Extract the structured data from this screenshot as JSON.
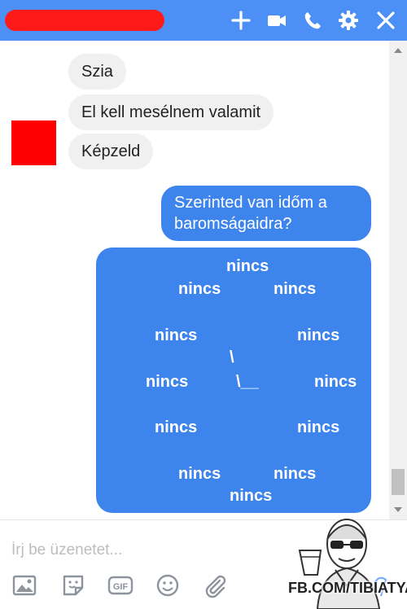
{
  "header": {
    "icons": [
      "plus-icon",
      "video-icon",
      "phone-icon",
      "gear-icon",
      "close-icon"
    ],
    "color": "#4c8ff5"
  },
  "messages": {
    "incoming": [
      "Szia",
      "El kell mesélnem valamit",
      "Képzeld"
    ],
    "outgoing_line1": "Szerinted van időm a",
    "outgoing_line2": "baromságaidra?"
  },
  "clock": {
    "word": "nincs",
    "hand_top": "\\",
    "hand_bottom": "\\__"
  },
  "composer": {
    "placeholder": "Írj be üzenetet...",
    "tools": [
      "image-icon",
      "sticker-icon",
      "gif-icon",
      "emoji-icon",
      "attachment-icon"
    ],
    "gif_label": "GIF"
  },
  "watermark": {
    "text": "FB.COM/TIBIATYA"
  },
  "colors": {
    "accent": "#3d84ec",
    "incoming_bubble": "#f1f0f0",
    "avatar": "#ff0000",
    "redaction": "#ff1a1a"
  }
}
